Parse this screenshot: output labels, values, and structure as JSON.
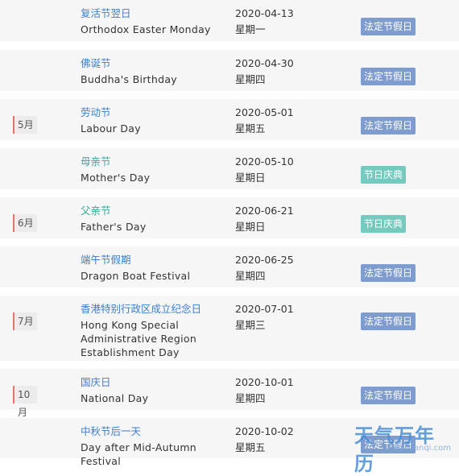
{
  "colors": {
    "row_bg": "#f6f6f6",
    "legal_badge": "#7f9ccf",
    "festival_badge": "#76c9bf",
    "link_blue": "#3d7fc9",
    "link_teal": "#3aa79a",
    "month_marker": "#e57373"
  },
  "rows": [
    {
      "month": "",
      "name_cn": "复活节翌日",
      "name_en": "Orthodox Easter Monday",
      "date": "2020-04-13",
      "weekday": "星期一",
      "badge": "法定节假日",
      "kind": "legal"
    },
    {
      "month": "",
      "name_cn": "佛诞节",
      "name_en": "Buddha's Birthday",
      "date": "2020-04-30",
      "weekday": "星期四",
      "badge": "法定节假日",
      "kind": "legal"
    },
    {
      "month": "5月",
      "name_cn": "劳动节",
      "name_en": "Labour Day",
      "date": "2020-05-01",
      "weekday": "星期五",
      "badge": "法定节假日",
      "kind": "legal"
    },
    {
      "month": "",
      "name_cn": "母亲节",
      "name_en": "Mother's Day",
      "date": "2020-05-10",
      "weekday": "星期日",
      "badge": "节日庆典",
      "kind": "festival"
    },
    {
      "month": "6月",
      "name_cn": "父亲节",
      "name_en": "Father's Day",
      "date": "2020-06-21",
      "weekday": "星期日",
      "badge": "节日庆典",
      "kind": "festival"
    },
    {
      "month": "",
      "name_cn": "端午节假期",
      "name_en": "Dragon Boat Festival",
      "date": "2020-06-25",
      "weekday": "星期四",
      "badge": "法定节假日",
      "kind": "legal"
    },
    {
      "month": "7月",
      "name_cn": "香港特别行政区成立纪念日",
      "name_en": "Hong Kong Special Administrative Region Establishment Day",
      "date": "2020-07-01",
      "weekday": "星期三",
      "badge": "法定节假日",
      "kind": "legal"
    },
    {
      "month": "10月",
      "name_cn": "国庆日",
      "name_en": "National Day",
      "date": "2020-10-01",
      "weekday": "星期四",
      "badge": "法定节假日",
      "kind": "legal"
    },
    {
      "month": "",
      "name_cn": "中秋节后一天",
      "name_en": "Day after Mid-Autumn Festival",
      "date": "2020-10-02",
      "weekday": "星期五",
      "badge": "法定节假日",
      "kind": "legal"
    }
  ],
  "watermark": {
    "logo": "天气万年历",
    "url": "www.tianqi.com"
  }
}
